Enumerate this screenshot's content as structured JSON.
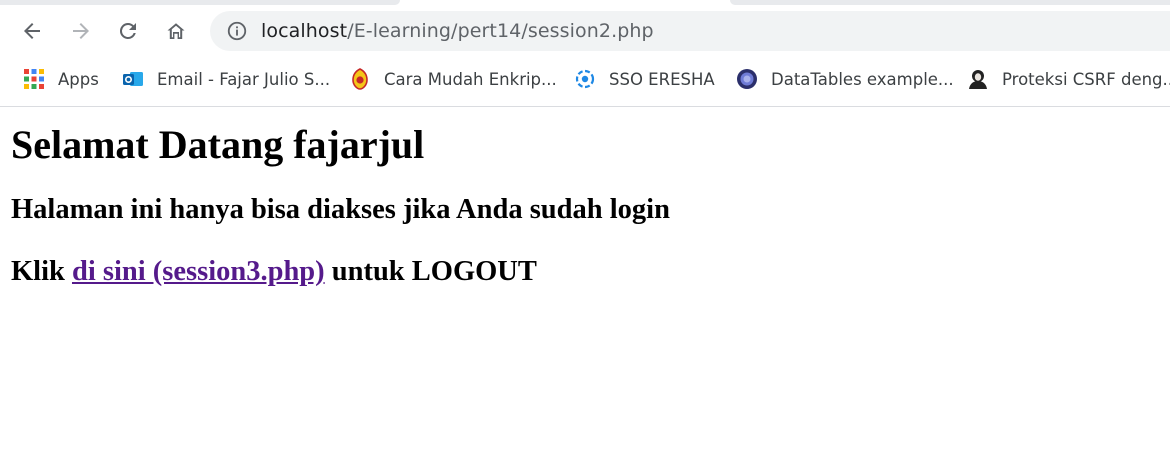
{
  "browser": {
    "url": {
      "host": "localhost",
      "path": "/E-learning/pert14/session2.php"
    },
    "bookmarks": [
      {
        "label": "Apps",
        "icon": "apps-grid-icon"
      },
      {
        "label": "Email - Fajar Julio S...",
        "icon": "outlook-icon"
      },
      {
        "label": "Cara Mudah Enkrip...",
        "icon": "site-favicon-icon"
      },
      {
        "label": "SSO ERESHA",
        "icon": "sso-eresha-icon"
      },
      {
        "label": "DataTables example...",
        "icon": "datatables-icon"
      },
      {
        "label": "Proteksi CSRF deng...",
        "icon": "avatar-favicon-icon"
      }
    ]
  },
  "page": {
    "greeting": "Selamat Datang fajarjul",
    "notice": "Halaman ini hanya bisa diakses jika Anda sudah login",
    "logout": {
      "prefix": "Klik ",
      "link_text": "di sini (session3.php)",
      "suffix": " untuk LOGOUT"
    }
  },
  "colors": {
    "link": "#551a8b",
    "text": "#000000",
    "omnibox_bg": "#f1f3f4"
  }
}
